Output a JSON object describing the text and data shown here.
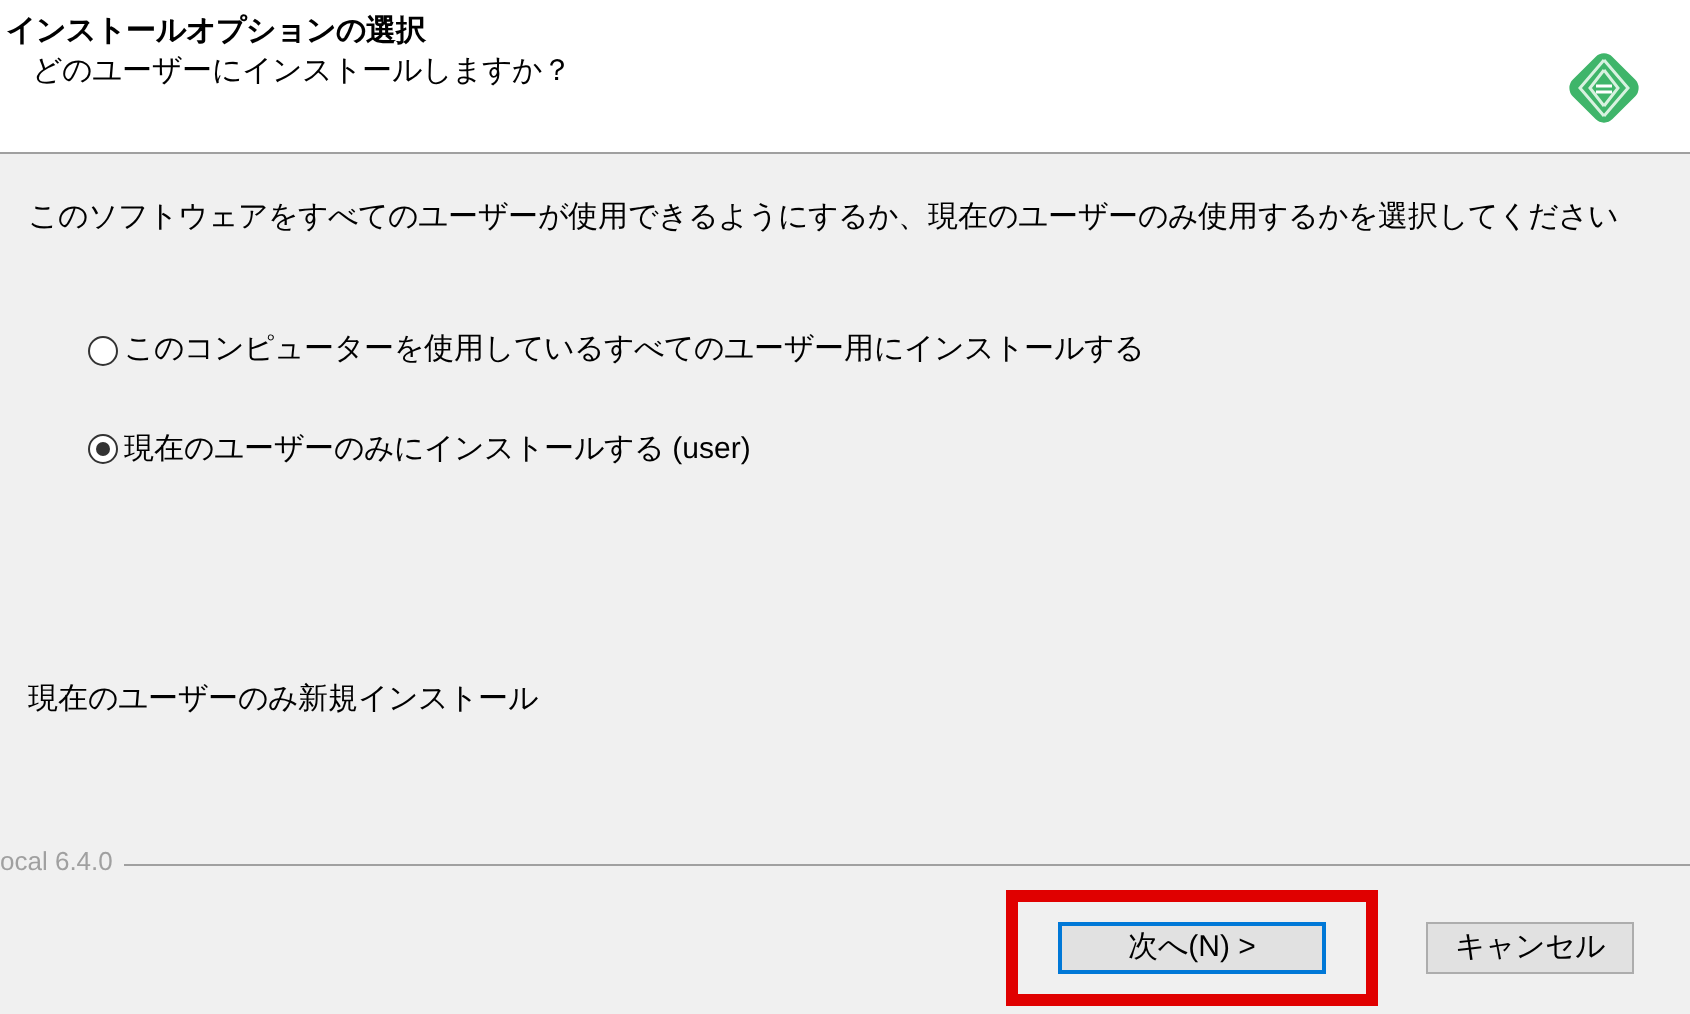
{
  "header": {
    "title": "インストールオプションの選択",
    "subtitle": "どのユーザーにインストールしますか？"
  },
  "description": "このソフトウェアをすべてのユーザーが使用できるようにするか、現在のユーザーのみ使用するかを選択してください",
  "options": [
    {
      "label": "このコンピューターを使用しているすべてのユーザー用にインストールする",
      "selected": false
    },
    {
      "label": "現在のユーザーのみにインストールする (user)",
      "selected": true
    }
  ],
  "status": "現在のユーザーのみ新規インストール",
  "branding": "ocal 6.4.0",
  "buttons": [
    {
      "label": "次へ(N) >",
      "focused": true,
      "highlighted": true
    },
    {
      "label": "キャンセル",
      "focused": false,
      "highlighted": false
    }
  ]
}
